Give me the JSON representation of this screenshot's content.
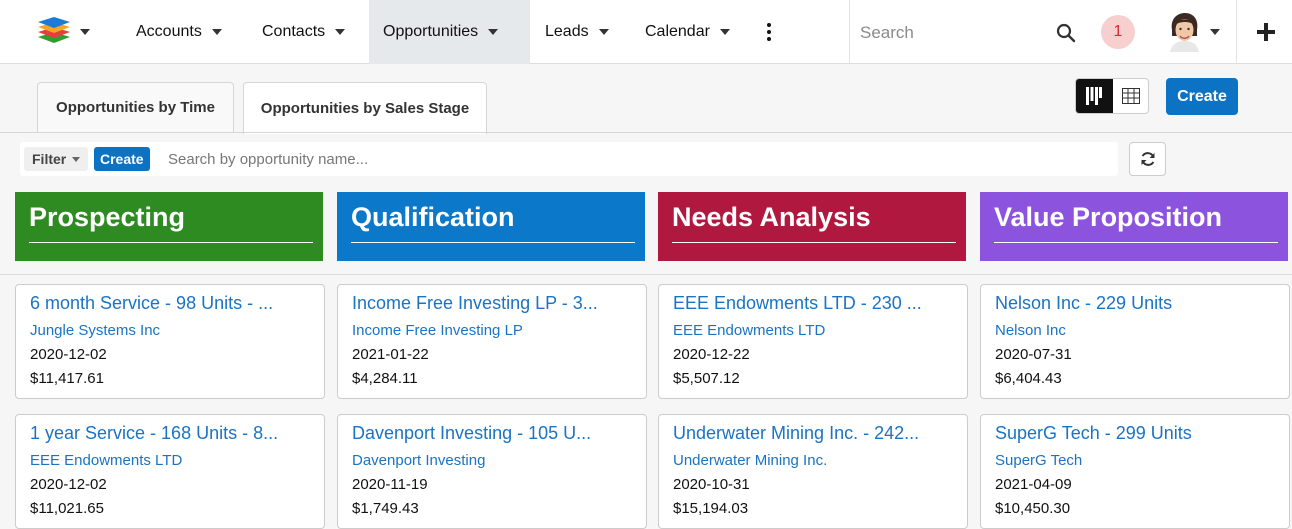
{
  "nav": {
    "items": [
      {
        "label": "Accounts"
      },
      {
        "label": "Contacts"
      },
      {
        "label": "Opportunities"
      },
      {
        "label": "Leads"
      },
      {
        "label": "Calendar"
      }
    ],
    "search_placeholder": "Search",
    "notification_count": "1",
    "active_item": "Opportunities"
  },
  "tabs": [
    {
      "label": "Opportunities by Time"
    },
    {
      "label": "Opportunities by Sales Stage"
    }
  ],
  "toolbar": {
    "create_label": "Create"
  },
  "filter": {
    "filter_label": "Filter",
    "create_label": "Create",
    "search_placeholder": "Search by opportunity name..."
  },
  "columns": [
    {
      "title": "Prospecting",
      "color": "#2e8b22",
      "cards": [
        {
          "title": "6 month Service - 98 Units - ...",
          "account": "Jungle Systems Inc",
          "date": "2020-12-02",
          "amount": "$11,417.61"
        },
        {
          "title": "1 year Service - 168 Units - 8...",
          "account": "EEE Endowments LTD",
          "date": "2020-12-02",
          "amount": "$11,021.65"
        }
      ]
    },
    {
      "title": "Qualification",
      "color": "#0b78c9",
      "cards": [
        {
          "title": "Income Free Investing LP - 3...",
          "account": "Income Free Investing LP",
          "date": "2021-01-22",
          "amount": "$4,284.11"
        },
        {
          "title": "Davenport Investing - 105 U...",
          "account": "Davenport Investing",
          "date": "2020-11-19",
          "amount": "$1,749.43"
        }
      ]
    },
    {
      "title": "Needs Analysis",
      "color": "#b01840",
      "cards": [
        {
          "title": "EEE Endowments LTD - 230 ...",
          "account": "EEE Endowments LTD",
          "date": "2020-12-22",
          "amount": "$5,507.12"
        },
        {
          "title": "Underwater Mining Inc. - 242...",
          "account": "Underwater Mining Inc.",
          "date": "2020-10-31",
          "amount": "$15,194.03"
        }
      ]
    },
    {
      "title": "Value Proposition",
      "color": "#8c53de",
      "cards": [
        {
          "title": "Nelson Inc - 229 Units",
          "account": "Nelson Inc",
          "date": "2020-07-31",
          "amount": "$6,404.43"
        },
        {
          "title": "SuperG Tech - 299 Units",
          "account": "SuperG Tech",
          "date": "2021-04-09",
          "amount": "$10,450.30"
        }
      ]
    }
  ]
}
